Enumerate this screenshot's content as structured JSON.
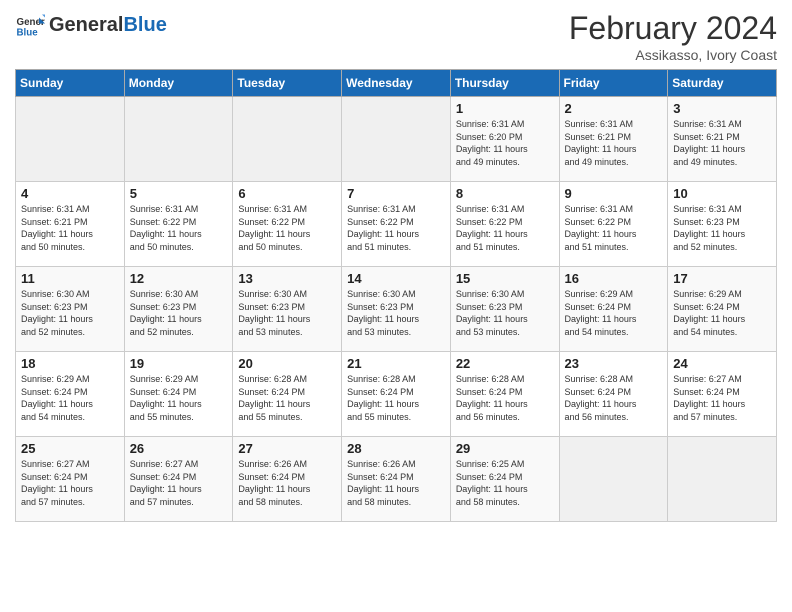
{
  "header": {
    "logo_text_general": "General",
    "logo_text_blue": "Blue",
    "title": "February 2024",
    "subtitle": "Assikasso, Ivory Coast"
  },
  "days_of_week": [
    "Sunday",
    "Monday",
    "Tuesday",
    "Wednesday",
    "Thursday",
    "Friday",
    "Saturday"
  ],
  "weeks": [
    [
      {
        "day": "",
        "info": ""
      },
      {
        "day": "",
        "info": ""
      },
      {
        "day": "",
        "info": ""
      },
      {
        "day": "",
        "info": ""
      },
      {
        "day": "1",
        "info": "Sunrise: 6:31 AM\nSunset: 6:20 PM\nDaylight: 11 hours\nand 49 minutes."
      },
      {
        "day": "2",
        "info": "Sunrise: 6:31 AM\nSunset: 6:21 PM\nDaylight: 11 hours\nand 49 minutes."
      },
      {
        "day": "3",
        "info": "Sunrise: 6:31 AM\nSunset: 6:21 PM\nDaylight: 11 hours\nand 49 minutes."
      }
    ],
    [
      {
        "day": "4",
        "info": "Sunrise: 6:31 AM\nSunset: 6:21 PM\nDaylight: 11 hours\nand 50 minutes."
      },
      {
        "day": "5",
        "info": "Sunrise: 6:31 AM\nSunset: 6:22 PM\nDaylight: 11 hours\nand 50 minutes."
      },
      {
        "day": "6",
        "info": "Sunrise: 6:31 AM\nSunset: 6:22 PM\nDaylight: 11 hours\nand 50 minutes."
      },
      {
        "day": "7",
        "info": "Sunrise: 6:31 AM\nSunset: 6:22 PM\nDaylight: 11 hours\nand 51 minutes."
      },
      {
        "day": "8",
        "info": "Sunrise: 6:31 AM\nSunset: 6:22 PM\nDaylight: 11 hours\nand 51 minutes."
      },
      {
        "day": "9",
        "info": "Sunrise: 6:31 AM\nSunset: 6:22 PM\nDaylight: 11 hours\nand 51 minutes."
      },
      {
        "day": "10",
        "info": "Sunrise: 6:31 AM\nSunset: 6:23 PM\nDaylight: 11 hours\nand 52 minutes."
      }
    ],
    [
      {
        "day": "11",
        "info": "Sunrise: 6:30 AM\nSunset: 6:23 PM\nDaylight: 11 hours\nand 52 minutes."
      },
      {
        "day": "12",
        "info": "Sunrise: 6:30 AM\nSunset: 6:23 PM\nDaylight: 11 hours\nand 52 minutes."
      },
      {
        "day": "13",
        "info": "Sunrise: 6:30 AM\nSunset: 6:23 PM\nDaylight: 11 hours\nand 53 minutes."
      },
      {
        "day": "14",
        "info": "Sunrise: 6:30 AM\nSunset: 6:23 PM\nDaylight: 11 hours\nand 53 minutes."
      },
      {
        "day": "15",
        "info": "Sunrise: 6:30 AM\nSunset: 6:23 PM\nDaylight: 11 hours\nand 53 minutes."
      },
      {
        "day": "16",
        "info": "Sunrise: 6:29 AM\nSunset: 6:24 PM\nDaylight: 11 hours\nand 54 minutes."
      },
      {
        "day": "17",
        "info": "Sunrise: 6:29 AM\nSunset: 6:24 PM\nDaylight: 11 hours\nand 54 minutes."
      }
    ],
    [
      {
        "day": "18",
        "info": "Sunrise: 6:29 AM\nSunset: 6:24 PM\nDaylight: 11 hours\nand 54 minutes."
      },
      {
        "day": "19",
        "info": "Sunrise: 6:29 AM\nSunset: 6:24 PM\nDaylight: 11 hours\nand 55 minutes."
      },
      {
        "day": "20",
        "info": "Sunrise: 6:28 AM\nSunset: 6:24 PM\nDaylight: 11 hours\nand 55 minutes."
      },
      {
        "day": "21",
        "info": "Sunrise: 6:28 AM\nSunset: 6:24 PM\nDaylight: 11 hours\nand 55 minutes."
      },
      {
        "day": "22",
        "info": "Sunrise: 6:28 AM\nSunset: 6:24 PM\nDaylight: 11 hours\nand 56 minutes."
      },
      {
        "day": "23",
        "info": "Sunrise: 6:28 AM\nSunset: 6:24 PM\nDaylight: 11 hours\nand 56 minutes."
      },
      {
        "day": "24",
        "info": "Sunrise: 6:27 AM\nSunset: 6:24 PM\nDaylight: 11 hours\nand 57 minutes."
      }
    ],
    [
      {
        "day": "25",
        "info": "Sunrise: 6:27 AM\nSunset: 6:24 PM\nDaylight: 11 hours\nand 57 minutes."
      },
      {
        "day": "26",
        "info": "Sunrise: 6:27 AM\nSunset: 6:24 PM\nDaylight: 11 hours\nand 57 minutes."
      },
      {
        "day": "27",
        "info": "Sunrise: 6:26 AM\nSunset: 6:24 PM\nDaylight: 11 hours\nand 58 minutes."
      },
      {
        "day": "28",
        "info": "Sunrise: 6:26 AM\nSunset: 6:24 PM\nDaylight: 11 hours\nand 58 minutes."
      },
      {
        "day": "29",
        "info": "Sunrise: 6:25 AM\nSunset: 6:24 PM\nDaylight: 11 hours\nand 58 minutes."
      },
      {
        "day": "",
        "info": ""
      },
      {
        "day": "",
        "info": ""
      }
    ]
  ]
}
